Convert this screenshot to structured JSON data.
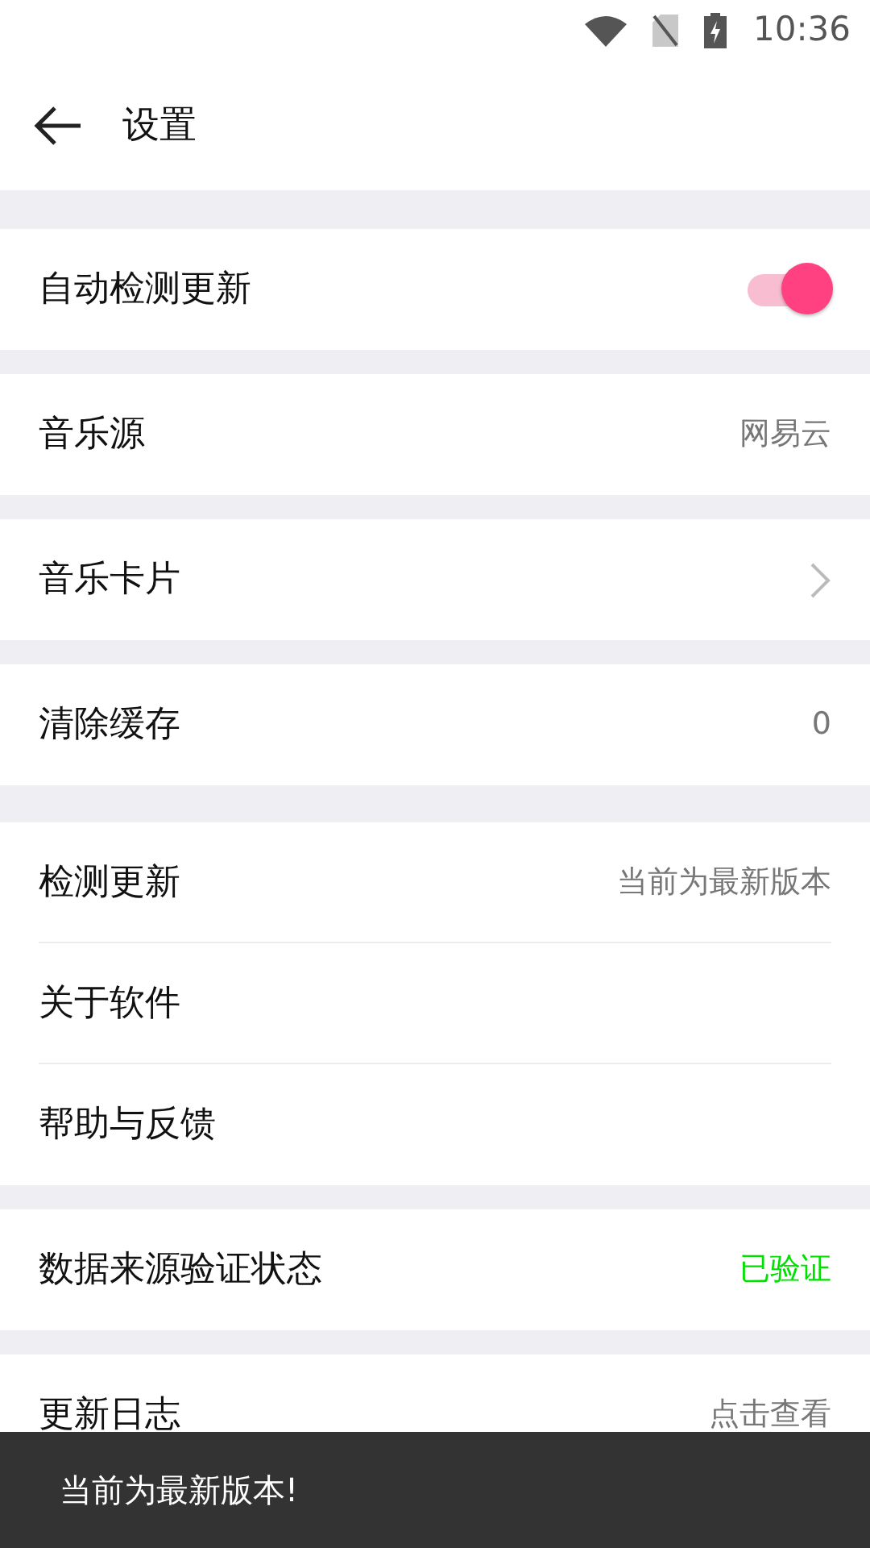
{
  "status_bar": {
    "time": "10:36"
  },
  "header": {
    "title": "设置"
  },
  "sections": [
    {
      "rows": [
        {
          "kind": "toggle",
          "label": "自动检测更新",
          "on": true
        }
      ]
    },
    {
      "rows": [
        {
          "kind": "value",
          "label": "音乐源",
          "value": "网易云",
          "color": "#777777"
        }
      ]
    },
    {
      "rows": [
        {
          "kind": "chevron",
          "label": "音乐卡片"
        }
      ]
    },
    {
      "rows": [
        {
          "kind": "value",
          "label": "清除缓存",
          "value": "0",
          "color": "#777777"
        }
      ]
    },
    {
      "rows": [
        {
          "kind": "value",
          "label": "检测更新",
          "value": "当前为最新版本",
          "color": "#777777"
        },
        {
          "kind": "plain",
          "label": "关于软件"
        },
        {
          "kind": "plain",
          "label": "帮助与反馈"
        }
      ]
    },
    {
      "rows": [
        {
          "kind": "value",
          "label": "数据来源验证状态",
          "value": "已验证",
          "color": "#00e000"
        }
      ]
    },
    {
      "rows": [
        {
          "kind": "value",
          "label": "更新日志",
          "value": "点击查看",
          "color": "#777777"
        }
      ]
    }
  ],
  "toast": {
    "text": "当前为最新版本!"
  }
}
